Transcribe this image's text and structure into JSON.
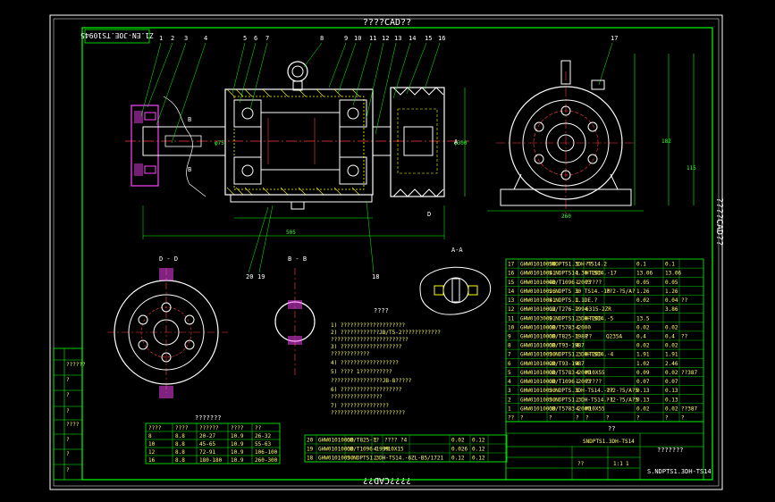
{
  "colors": {
    "background": "#000000",
    "frame_outer": "#ffffff",
    "frame_inner": "#00ff00",
    "part_outline": "#ffffff",
    "dimension": "#00ff00",
    "centerline": "#ff3b3b",
    "hatch": "#ffff00",
    "highlight": "#ff44ff"
  },
  "title_top": "????CAD??",
  "title_bottom": "????CAD??",
  "title_side": "????CAD??",
  "drawing_code_topleft": "Z1.EN-JOE.TS10945",
  "drawing_code_bottomright": "S.NDPTS1.3DH-TS14",
  "leader_numbers": [
    "1",
    "2",
    "3",
    "4",
    "5",
    "6",
    "7",
    "8",
    "9",
    "10",
    "11",
    "12",
    "13",
    "14",
    "15",
    "16",
    "17",
    "18",
    "19",
    "20"
  ],
  "section_labels": {
    "dd": "D - D",
    "bb": "B - B",
    "aa": "A-A",
    "b_marker": "B",
    "d_marker": "D",
    "a_marker": "A"
  },
  "notes_title": "????",
  "notes": [
    "1) ????????????????????",
    "2) ????????????JB/T5-2????????????",
    "   ????????????????????????",
    "3) ???????????????????",
    "   ????????????",
    "4) ??????????????????",
    "5) ???? 1??????????",
    "   ????????????????JB-8?????",
    "6) ???????????????????",
    "   ????????????????",
    "7) ???????????????",
    "   ???????????????????????"
  ],
  "spec_table": {
    "title": "???????",
    "headers": [
      "????",
      "????",
      "??????",
      "????",
      "??"
    ],
    "rows": [
      [
        "8",
        "8.8",
        "20-27",
        "10.9",
        "26-32"
      ],
      [
        "10",
        "8.8",
        "45-65",
        "10.9",
        "55-63"
      ],
      [
        "12",
        "8.8",
        "72-91",
        "10.9",
        "106-100"
      ],
      [
        "16",
        "8.8",
        "180-180",
        "10.9",
        "260-300"
      ]
    ]
  },
  "bom_rows": [
    [
      "17",
      "GHW01010030",
      "SNDPTS1.3DH-TS14.2",
      "1",
      "??",
      "",
      "0.1",
      "0.1",
      ""
    ],
    [
      "16",
      "GHW01010041",
      "S.NDPTS14.30 TS14.-17",
      "1",
      "HT200",
      "",
      "13.06",
      "13.06",
      ""
    ],
    [
      "15",
      "GHW01010040",
      "GB/T1096-2003",
      "1",
      "?????",
      "",
      "0.05",
      "0.05",
      ""
    ],
    [
      "14",
      "GHW01010026",
      "S.NDPTS 30 TS14.-10",
      "1",
      "",
      "??2-?5/A?",
      "1.26",
      "1.26",
      ""
    ],
    [
      "13",
      "GHW01010041",
      "S.NDPTS.1.1DE.?",
      "1",
      "",
      "",
      "0.02",
      "0.04",
      "??"
    ],
    [
      "12",
      "GHW01010012",
      "GB/T276-1994",
      "2",
      "6315-2ZR",
      "",
      "",
      "3.86",
      ""
    ],
    [
      "11",
      "GHW01030001",
      "S.NDPTS1.3DH-TS14.-5",
      "1",
      "HT200",
      "",
      "13.5",
      ""
    ],
    [
      "10",
      "GHW01010030",
      "GB/T5783-2000",
      "4",
      "",
      "",
      "0.02",
      "0.02",
      ""
    ],
    [
      "9",
      "GHW01010030",
      "GB/T825-1988",
      "1",
      "??",
      "Q235A",
      "0.4",
      "0.4",
      "??"
    ],
    [
      "8",
      "GHW01010030",
      "GB/T93-1987",
      "4",
      "",
      "",
      "0.02",
      "0.02",
      ""
    ],
    [
      "7",
      "GHW01010030",
      "S.NDPTS1.3DH-TS14.-4",
      "1",
      "HT200",
      "",
      "1.91",
      "1.91",
      ""
    ],
    [
      "6",
      "GHW01010020",
      "GB/T93-1987",
      "4",
      "",
      "",
      "1.02",
      "2.46",
      ""
    ],
    [
      "5",
      "GHW01010030",
      "GB/T5783-2000",
      "4",
      "M10X55",
      "",
      "0.09",
      "0.02",
      "??387"
    ],
    [
      "4",
      "GHW01010030",
      "GB/T1096-2003",
      "1",
      "?????",
      "",
      "0.07",
      "0.07",
      ""
    ],
    [
      "3",
      "GHW01010030",
      "S.NDPTS.3DH-TS14.-2?",
      "1",
      "",
      "??2-?5/A?5",
      "0.13",
      "0.13",
      ""
    ],
    [
      "2",
      "GHW01010030",
      "S.NDPTS1.3DH-TS14.-1",
      "1",
      "",
      "??2-?5/A?5",
      "0.13",
      "0.13",
      ""
    ],
    [
      "1",
      "GHW01010030",
      "GB/T5783-2000",
      "4",
      "M10X55",
      "",
      "0.02",
      "0.02",
      "??387"
    ]
  ],
  "bom_header": [
    "??",
    "?",
    "?",
    "?",
    "?",
    "?",
    "?",
    "?",
    "?"
  ],
  "lower_bom_rows": [
    [
      "20",
      "GHW01010030",
      "GB/T825-??",
      "1",
      "???? ?4",
      "",
      "0.02",
      "0.12",
      ""
    ],
    [
      "19",
      "GHW01010030",
      "GB/T1096-1999",
      "4",
      "M10X15",
      "",
      "0.026",
      "0.12",
      ""
    ],
    [
      "18",
      "GHW01010030",
      "S.NDPTS1.3DH-TS14.-6",
      "1",
      "",
      "ZL-B5/1721",
      "0.12",
      "0.12",
      ""
    ]
  ],
  "title_block": {
    "name_main": "??",
    "name_sub": "SNDPTS1.3DH-TS14",
    "company": "???????",
    "scale_label": "1:1",
    "sheet_label": "??",
    "count_label": "1"
  },
  "left_strip_labels": [
    "??????",
    "?",
    "?",
    "?",
    "????",
    "?",
    "?",
    "?"
  ],
  "dim_labels": {
    "overall_length": "505",
    "shaft_dia": "φ75",
    "pulley_dia": "φ300",
    "height": "182",
    "base_width": "260",
    "center_height": "115"
  }
}
